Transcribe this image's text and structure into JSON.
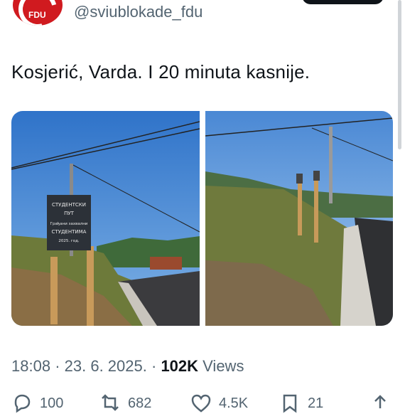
{
  "account": {
    "avatar_text": "FDU",
    "handle": "@sviublokade_fdu"
  },
  "tweet": {
    "text": "Kosjerić, Varda. I 20 minuta kasnije."
  },
  "photos": {
    "left_sign_lines": [
      "СТУДЕНТСКИ",
      "ПУТ",
      "Грађани захвални",
      "СТУДЕНТИМА",
      "2025. год."
    ]
  },
  "meta": {
    "time": "18:08",
    "date": "23. 6. 2025.",
    "views_count": "102K",
    "views_label": "Views"
  },
  "actions": {
    "replies": "100",
    "reposts": "682",
    "likes": "4.5K",
    "bookmarks": "21"
  }
}
